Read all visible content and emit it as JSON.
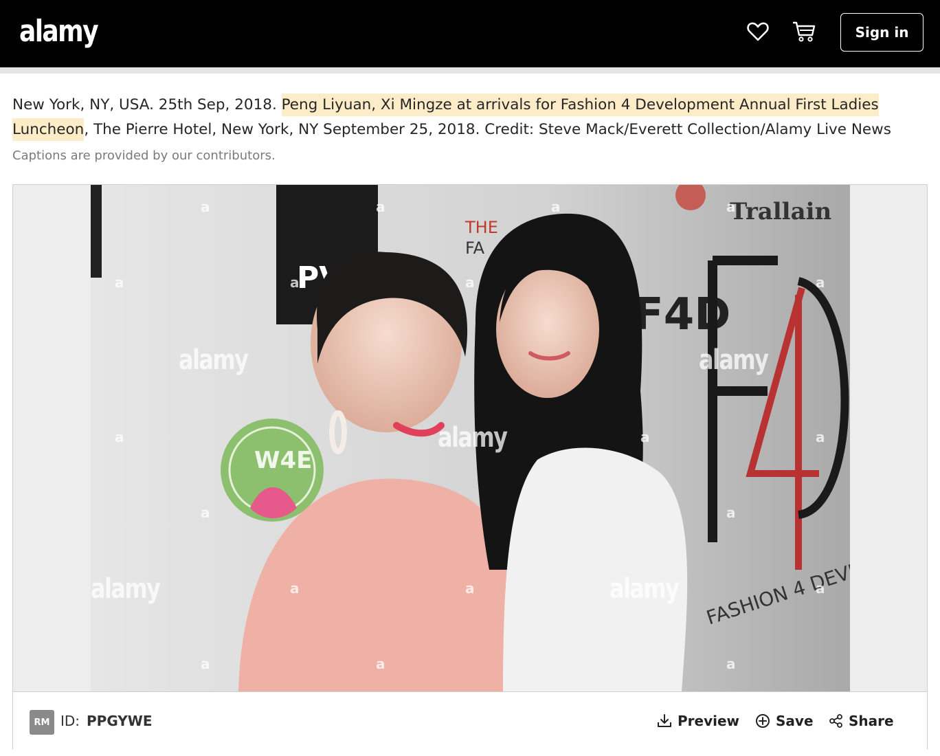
{
  "header": {
    "logo_text": "alamy",
    "favorites_icon": "heart-icon",
    "cart_icon": "cart-icon",
    "signin_label": "Sign in"
  },
  "caption": {
    "prefix": "New York, NY, USA. 25th Sep, 2018. ",
    "highlight": "Peng Liyuan, Xi Mingze at arrivals for Fashion 4 Development Annual First Ladies Luncheon",
    "suffix": ", The Pierre Hotel, New York, NY September 25, 2018. Credit: Steve Mack/Everett Collection/Alamy Live News",
    "highlight_color": "#fdecc8",
    "note": "Captions are provided by our contributors."
  },
  "image": {
    "watermark_text": "alamy",
    "watermark_small": "a"
  },
  "info": {
    "license_badge": "RM",
    "id_label": "ID:",
    "id_value": "PPGYWE",
    "actions": {
      "preview_label": "Preview",
      "preview_icon": "download-icon",
      "save_label": "Save",
      "save_icon": "plus-circle-icon",
      "share_label": "Share",
      "share_icon": "share-icon"
    }
  },
  "colors": {
    "header_bg": "#000000",
    "highlight": "#fdecc8",
    "badge_bg": "#8a8a8a"
  }
}
